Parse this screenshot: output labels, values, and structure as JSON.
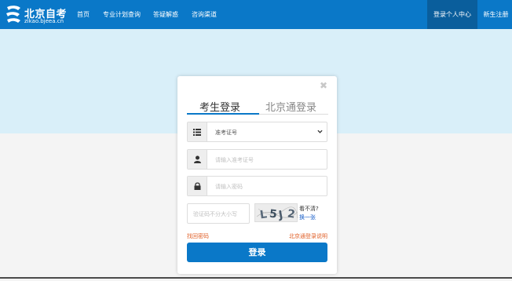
{
  "brand": {
    "title": "北京自考",
    "subtitle": "zikao.bjeea.cn"
  },
  "nav": {
    "links": [
      "首页",
      "专业计划查询",
      "答疑解惑",
      "咨询渠道"
    ],
    "right": [
      "登录个人中心",
      "新生注册"
    ]
  },
  "login": {
    "tabs": [
      "考生登录",
      "北京通登录"
    ],
    "id_type": {
      "selected": "准考证号"
    },
    "id_placeholder": "请输入准考证号",
    "password_placeholder": "请输入密码",
    "captcha": {
      "placeholder": "验证码不分大小写",
      "code": "L5J2",
      "unclear_text": "看不清?",
      "refresh_text": "换一张"
    },
    "forgot_password": "找回密码",
    "beijingtong_help": "北京通登录说明",
    "submit_label": "登录"
  },
  "colors": {
    "primary": "#0a78c8",
    "nav_active": "#0a5e9c",
    "hero": "#d9eff9",
    "link_orange": "#e0612a",
    "refresh_link": "#1a5fc9"
  },
  "icons": {
    "logo": "zikao-logo-icon",
    "list": "list-icon",
    "user": "user-icon",
    "lock": "lock-icon",
    "close": "close-icon",
    "dropdown": "chevron-down-icon"
  }
}
